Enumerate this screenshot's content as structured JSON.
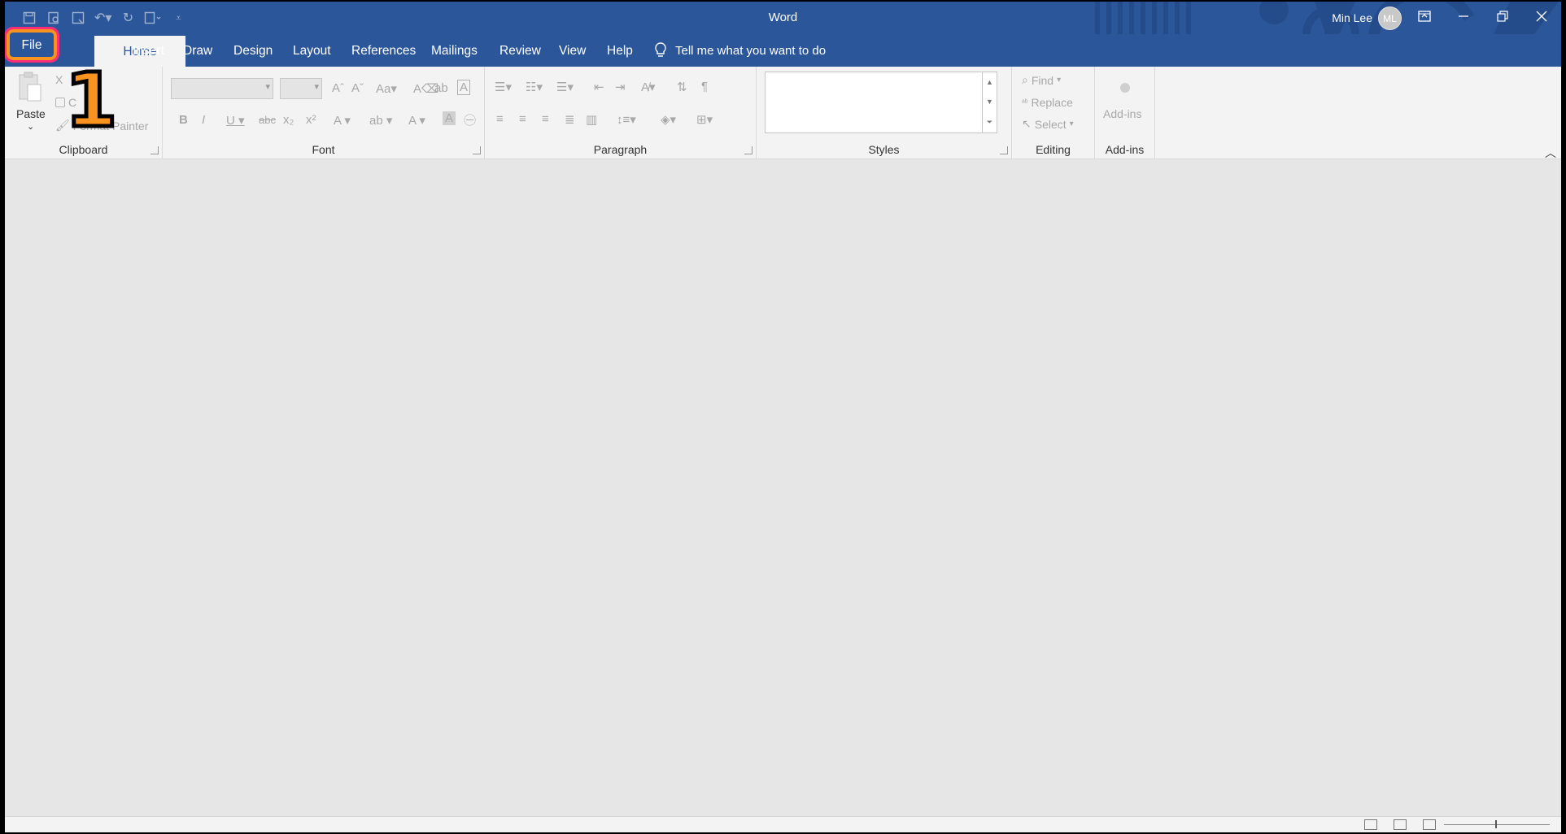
{
  "window": {
    "app_title": "Word",
    "user_name": "Min Lee",
    "user_initials": "ML"
  },
  "quick_access": [
    "save-icon",
    "print-preview-icon",
    "save-as-icon",
    "undo-icon",
    "redo-icon",
    "touch-mode-icon",
    "customize-icon"
  ],
  "tabs": {
    "file": "File",
    "home": "Home",
    "insert": "Insert",
    "draw": "Draw",
    "design": "Design",
    "layout": "Layout",
    "references": "References",
    "mailings": "Mailings",
    "review": "Review",
    "view": "View",
    "help": "Help"
  },
  "tell_me": {
    "label": "Tell me what you want to do"
  },
  "ribbon": {
    "clipboard": {
      "label": "Clipboard",
      "paste": "Paste",
      "cut": "X",
      "copy": "C",
      "format_painter": "Format Painter"
    },
    "font": {
      "label": "Font"
    },
    "paragraph": {
      "label": "Paragraph"
    },
    "styles": {
      "label": "Styles"
    },
    "editing": {
      "label": "Editing",
      "find": "Find",
      "replace": "Replace",
      "select": "Select"
    },
    "addins": {
      "label": "Add-ins",
      "button": "Add-ins"
    }
  },
  "annotation": {
    "step": "1"
  },
  "colors": {
    "title_bar": "#2b579a",
    "ribbon": "#f3f3f3",
    "canvas": "#e6e6e6",
    "highlight_outer": "#ff2d78",
    "highlight_inner": "#f7931e"
  }
}
